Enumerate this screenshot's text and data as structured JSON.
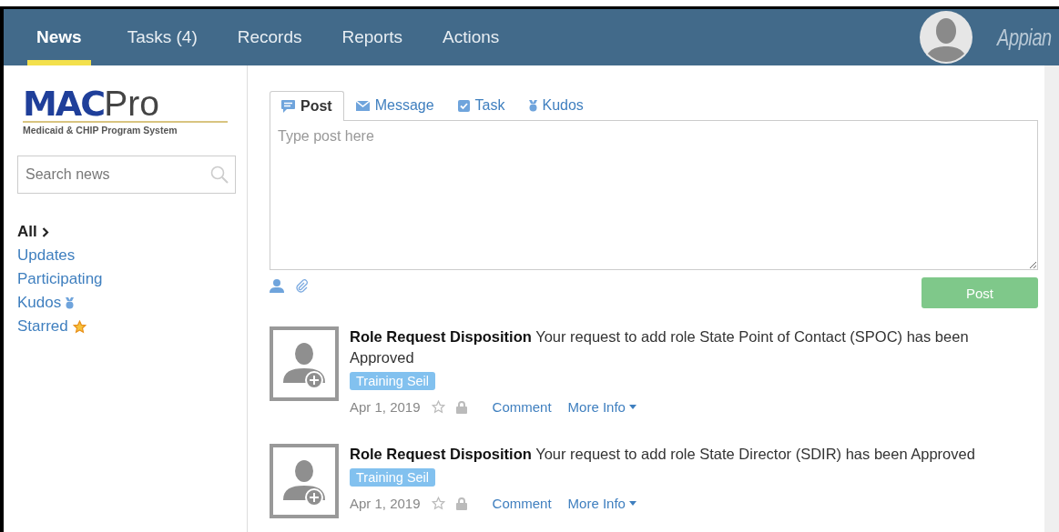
{
  "nav": {
    "tabs": [
      {
        "label": "News",
        "selected": true
      },
      {
        "label": "Tasks (4)",
        "selected": false
      },
      {
        "label": "Records",
        "selected": false
      },
      {
        "label": "Reports",
        "selected": false
      },
      {
        "label": "Actions",
        "selected": false
      }
    ],
    "brand": "Appian"
  },
  "sidebar": {
    "logo": {
      "primary": "MAC",
      "secondary": "Pro",
      "tagline": "Medicaid & CHIP Program System"
    },
    "search": {
      "placeholder": "Search news"
    },
    "filters": [
      {
        "label": "All",
        "selected": true,
        "kind": "plain"
      },
      {
        "label": "Updates",
        "selected": false,
        "kind": "plain"
      },
      {
        "label": "Participating",
        "selected": false,
        "kind": "plain"
      },
      {
        "label": "Kudos",
        "selected": false,
        "kind": "medal"
      },
      {
        "label": "Starred",
        "selected": false,
        "kind": "star"
      }
    ]
  },
  "composer": {
    "tabs": [
      {
        "label": "Post",
        "selected": true,
        "kind": "post"
      },
      {
        "label": "Message",
        "selected": false,
        "kind": "message"
      },
      {
        "label": "Task",
        "selected": false,
        "kind": "task"
      },
      {
        "label": "Kudos",
        "selected": false,
        "kind": "kudos"
      }
    ],
    "placeholder": "Type post here",
    "button": "Post"
  },
  "feed": [
    {
      "text": "**Role Request Disposition** Your request to add role State Point of Contact (SPOC) has been Approved",
      "tag": "Training Seil",
      "date": "Apr 1, 2019",
      "comment": "Comment",
      "more": "More Info"
    },
    {
      "text": "**Role Request Disposition** Your request to add role State Director (SDIR) has been Approved",
      "tag": "Training Seil",
      "date": "Apr 1, 2019",
      "comment": "Comment",
      "more": "More Info"
    }
  ]
}
